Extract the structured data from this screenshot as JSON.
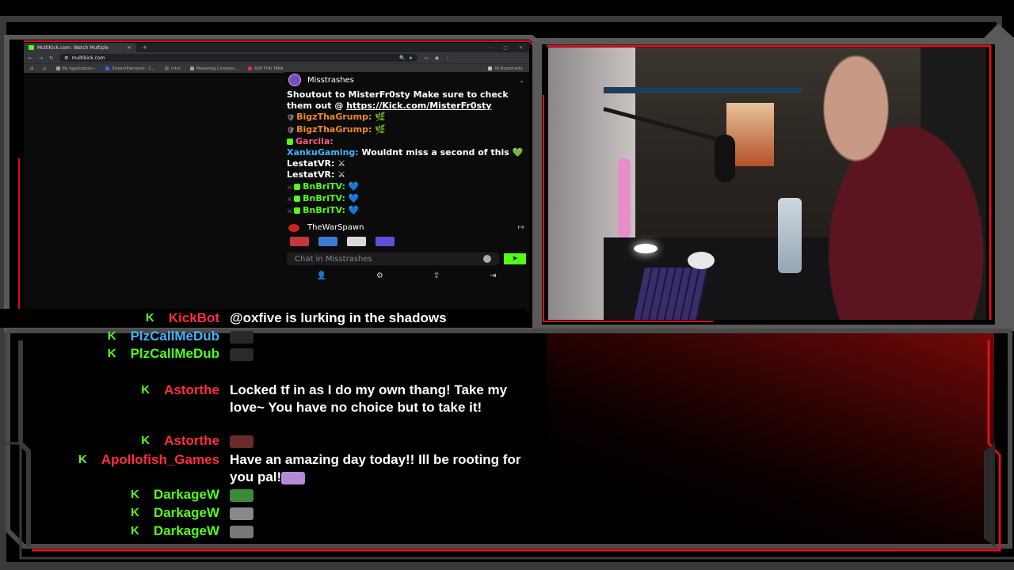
{
  "browser": {
    "tab_title": "MultiKick.com: Watch Multiple",
    "tab_close": "×",
    "new_tab": "+",
    "url": "multikick.com",
    "bookmarks": [
      {
        "label": "My Applications -",
        "color": "#9aa0a6"
      },
      {
        "label": "StreamElements - C...",
        "color": "#3b63f3"
      },
      {
        "label": "Intro",
        "color": "#666666"
      },
      {
        "label": "Mastering Compres...",
        "color": "#9aa0a6"
      },
      {
        "label": "ADP FOR TARA",
        "color": "#d93025"
      }
    ],
    "all_bookmarks": "All Bookmarks"
  },
  "kick_chat": {
    "channel": "Misstrashes",
    "messages": [
      {
        "user": "",
        "text": "Shoutout to MisterFr0sty Make sure to check them out @ ",
        "link": "https://Kick.com/MisterFr0sty"
      },
      {
        "user": "BigzThaGrump:",
        "color": "#f08a24",
        "text": "🌿",
        "badge": "🛡"
      },
      {
        "user": "BigzThaGrump:",
        "color": "#f08a24",
        "text": "🌿",
        "badge": "🛡"
      },
      {
        "user": "Garcila:",
        "color": "#ff5a7a",
        "text": "",
        "gbadge": true
      },
      {
        "user": "XankuGaming:",
        "color": "#3fb6ff",
        "text": "Wouldnt miss a second of this 💚"
      },
      {
        "user": "LestatVR:",
        "color": "#ffffff",
        "text": "⚔"
      },
      {
        "user": "LestatVR:",
        "color": "#ffffff",
        "text": "⚔"
      },
      {
        "user": "BnBriTV:",
        "color": "#53fc18",
        "text": "💙",
        "badge": "⚔",
        "gbadge": true
      },
      {
        "user": "BnBriTV:",
        "color": "#53fc18",
        "text": "💙",
        "badge": "⚔",
        "gbadge": true
      },
      {
        "user": "BnBriTV:",
        "color": "#53fc18",
        "text": "💙",
        "badge": "⚔",
        "gbadge": true
      }
    ],
    "pinned_user": "TheWarSpawn",
    "input_placeholder": "Chat in Misstrashes",
    "send_icon": "➤",
    "footer_icons": [
      "add-user",
      "gear",
      "share",
      "exit"
    ]
  },
  "overlay_chat": [
    {
      "name": "KickBot",
      "color": "#ff2d3f",
      "text": "@oxfive is lurking in the shadows"
    },
    {
      "name": "PlzCallMeDub",
      "color": "#3fb6ff",
      "text": "",
      "emote": "#2a2a2a"
    },
    {
      "name": "PlzCallMeDub",
      "color": "#53fc18",
      "text": "",
      "emote": "#2a2a2a"
    },
    {
      "name": "Astorthe",
      "color": "#ff2d3f",
      "text": "Locked tf in as I do my own thang! Take my love~ You have no choice but to take it!"
    },
    {
      "name": "Astorthe",
      "color": "#ff2d3f",
      "text": "",
      "emote": "#6b2a2a"
    },
    {
      "name": "Apollofish_Games",
      "color": "#ff2d3f",
      "text": "Have an amazing day today!! Ill be rooting for you pal!",
      "emote": "#b48ad6"
    },
    {
      "name": "DarkageW",
      "color": "#53fc18",
      "text": "",
      "emote": "#3a8a3a"
    },
    {
      "name": "DarkageW",
      "color": "#53fc18",
      "text": "",
      "emote": "#888888"
    },
    {
      "name": "DarkageW",
      "color": "#53fc18",
      "text": "",
      "emote": "#777777"
    }
  ],
  "overlay_k": "K",
  "colors": {
    "kick_green": "#53fc18",
    "frame": "#7a7a7a",
    "frame_red": "#d8121f"
  }
}
